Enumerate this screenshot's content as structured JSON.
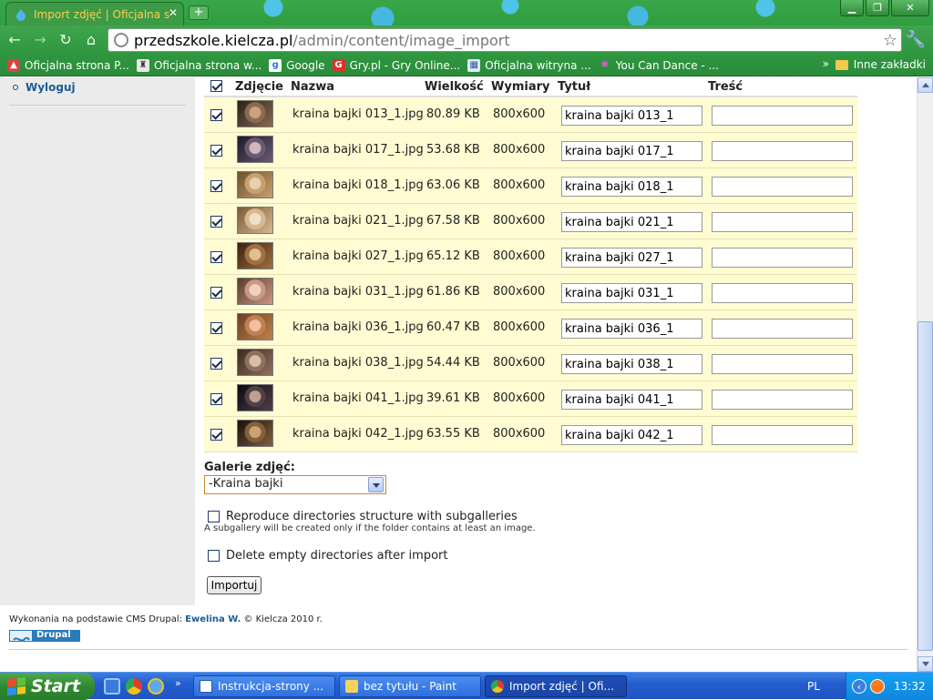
{
  "browser": {
    "tab_title": "Import zdjęć | Oficjalna s",
    "new_tab_label": "+",
    "url_host": "przedszkole.kielcza.pl",
    "url_path": "/admin/content/image_import",
    "bookmarks": [
      {
        "label": "Oficjalna strona P...",
        "icon": "school-icon"
      },
      {
        "label": "Oficjalna strona w...",
        "icon": "crest-icon"
      },
      {
        "label": "Google",
        "icon": "google-icon"
      },
      {
        "label": "Gry.pl - Gry Online...",
        "icon": "gry-icon"
      },
      {
        "label": "Oficjalna witryna ...",
        "icon": "page-icon"
      },
      {
        "label": "You Can Dance - ...",
        "icon": "star-icon"
      }
    ],
    "bookmarks_more": "»",
    "other_bookmarks": "Inne zakładki"
  },
  "sidebar": {
    "logout_label": "Wyloguj"
  },
  "table": {
    "headers": {
      "photo": "Zdjęcie",
      "name": "Nazwa",
      "size": "Wielkość",
      "dimensions": "Wymiary",
      "title": "Tytuł",
      "body": "Treść"
    },
    "header_checked": true,
    "rows": [
      {
        "checked": true,
        "name": "kraina bajki 013_1.jpg",
        "size": "80.89 KB",
        "dims": "800x600",
        "title": "kraina bajki 013_1",
        "body": ""
      },
      {
        "checked": true,
        "name": "kraina bajki 017_1.jpg",
        "size": "53.68 KB",
        "dims": "800x600",
        "title": "kraina bajki 017_1",
        "body": ""
      },
      {
        "checked": true,
        "name": "kraina bajki 018_1.jpg",
        "size": "63.06 KB",
        "dims": "800x600",
        "title": "kraina bajki 018_1",
        "body": ""
      },
      {
        "checked": true,
        "name": "kraina bajki 021_1.jpg",
        "size": "67.58 KB",
        "dims": "800x600",
        "title": "kraina bajki 021_1",
        "body": ""
      },
      {
        "checked": true,
        "name": "kraina bajki 027_1.jpg",
        "size": "65.12 KB",
        "dims": "800x600",
        "title": "kraina bajki 027_1",
        "body": ""
      },
      {
        "checked": true,
        "name": "kraina bajki 031_1.jpg",
        "size": "61.86 KB",
        "dims": "800x600",
        "title": "kraina bajki 031_1",
        "body": ""
      },
      {
        "checked": true,
        "name": "kraina bajki 036_1.jpg",
        "size": "60.47 KB",
        "dims": "800x600",
        "title": "kraina bajki 036_1",
        "body": ""
      },
      {
        "checked": true,
        "name": "kraina bajki 038_1.jpg",
        "size": "54.44 KB",
        "dims": "800x600",
        "title": "kraina bajki 038_1",
        "body": ""
      },
      {
        "checked": true,
        "name": "kraina bajki 041_1.jpg",
        "size": "39.61 KB",
        "dims": "800x600",
        "title": "kraina bajki 041_1",
        "body": ""
      },
      {
        "checked": true,
        "name": "kraina bajki 042_1.jpg",
        "size": "63.55 KB",
        "dims": "800x600",
        "title": "kraina bajki 042_1",
        "body": ""
      }
    ]
  },
  "form": {
    "gallery_label": "Galerie zdjęć:",
    "gallery_selected": "-Kraina bajki",
    "reproduce_label": "Reproduce directories structure with subgalleries",
    "reproduce_checked": false,
    "reproduce_desc": "A subgallery will be created only if the folder contains at least an image.",
    "delete_label": "Delete empty directories after import",
    "delete_checked": false,
    "import_button": "Importuj"
  },
  "footer": {
    "text_before": "Wykonania na podstawie CMS Drupal: ",
    "author": "Ewelina W.",
    "text_after": " © Kielcza 2010 r.",
    "badge_label": "Drupal"
  },
  "taskbar": {
    "start_label": "Start",
    "quicklaunch_more": "»",
    "tasks": [
      {
        "label": "Instrukcja-strony ...",
        "active": false
      },
      {
        "label": "bez tytułu - Paint",
        "active": false
      },
      {
        "label": "Import zdjęć | Ofi...",
        "active": true
      }
    ],
    "language": "PL",
    "tray_chevron": "‹",
    "clock": "13:32"
  },
  "colors": {
    "row_background": "#fffbd2",
    "link": "#1a5d96",
    "sidebar_background": "#ebebeb",
    "browser_theme": "#2f9e3f"
  }
}
